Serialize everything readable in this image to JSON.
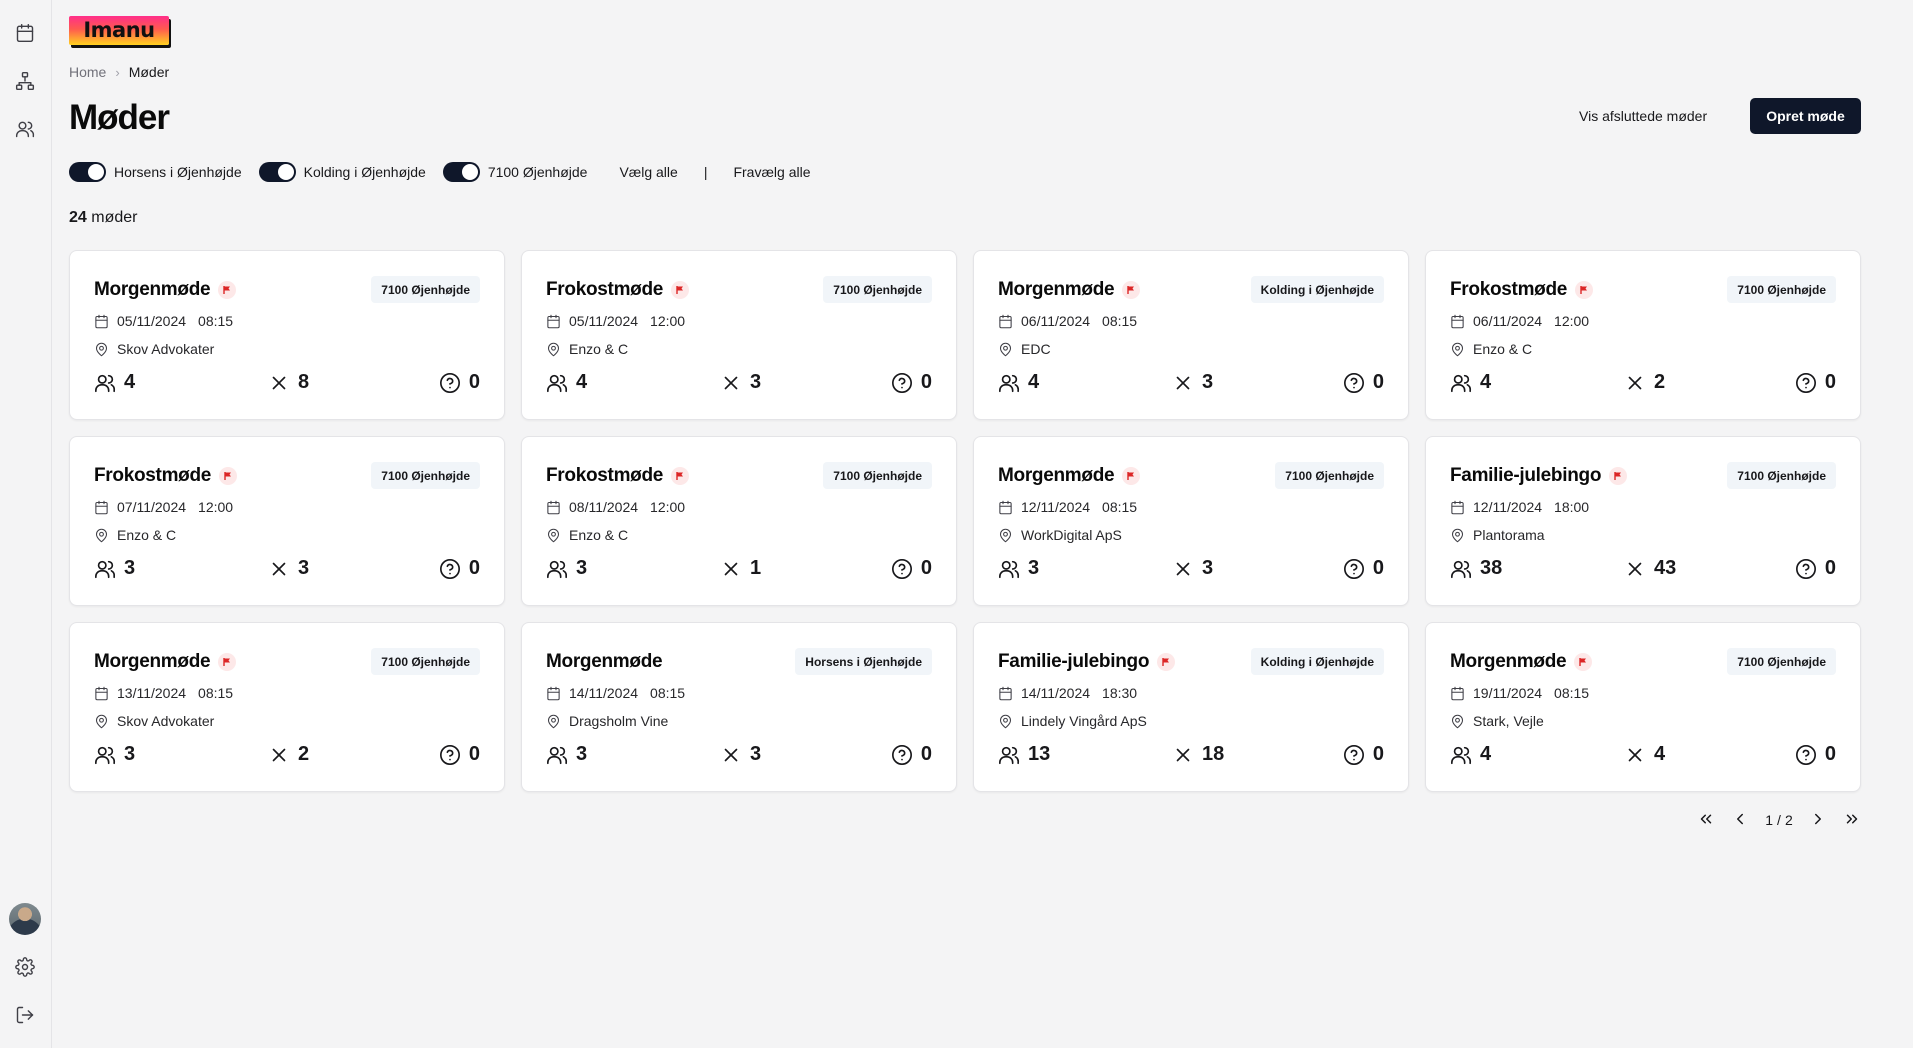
{
  "app": {
    "logo_text": "Imanu"
  },
  "sidebar": {
    "items": [
      {
        "name": "calendar-icon"
      },
      {
        "name": "org-chart-icon"
      },
      {
        "name": "users-icon"
      }
    ],
    "bottom": [
      {
        "name": "avatar"
      },
      {
        "name": "gear-icon"
      },
      {
        "name": "logout-icon"
      }
    ]
  },
  "breadcrumb": {
    "home": "Home",
    "separator": "›",
    "current": "Møder"
  },
  "page": {
    "title": "Møder"
  },
  "actions": {
    "show_finished": "Vis afsluttede møder",
    "create": "Opret møde"
  },
  "filters": {
    "items": [
      {
        "label": "Horsens i Øjenhøjde",
        "on": true
      },
      {
        "label": "Kolding i Øjenhøjde",
        "on": true
      },
      {
        "label": "7100 Øjenhøjde",
        "on": true
      }
    ],
    "select_all": "Vælg alle",
    "divider": "|",
    "deselect_all": "Fravælg alle"
  },
  "summary": {
    "count": "24",
    "unit": "møder"
  },
  "meetings": [
    {
      "title": "Morgenmøde",
      "flagged": true,
      "group": "7100 Øjenhøjde",
      "date": "05/11/2024",
      "time": "08:15",
      "location": "Skov Advokater",
      "attendees": "4",
      "declined": "8",
      "unknown": "0"
    },
    {
      "title": "Frokostmøde",
      "flagged": true,
      "group": "7100 Øjenhøjde",
      "date": "05/11/2024",
      "time": "12:00",
      "location": "Enzo & C",
      "attendees": "4",
      "declined": "3",
      "unknown": "0"
    },
    {
      "title": "Morgenmøde",
      "flagged": true,
      "group": "Kolding i Øjenhøjde",
      "date": "06/11/2024",
      "time": "08:15",
      "location": "EDC",
      "attendees": "4",
      "declined": "3",
      "unknown": "0"
    },
    {
      "title": "Frokostmøde",
      "flagged": true,
      "group": "7100 Øjenhøjde",
      "date": "06/11/2024",
      "time": "12:00",
      "location": "Enzo & C",
      "attendees": "4",
      "declined": "2",
      "unknown": "0"
    },
    {
      "title": "Frokostmøde",
      "flagged": true,
      "group": "7100 Øjenhøjde",
      "date": "07/11/2024",
      "time": "12:00",
      "location": "Enzo & C",
      "attendees": "3",
      "declined": "3",
      "unknown": "0"
    },
    {
      "title": "Frokostmøde",
      "flagged": true,
      "group": "7100 Øjenhøjde",
      "date": "08/11/2024",
      "time": "12:00",
      "location": "Enzo & C",
      "attendees": "3",
      "declined": "1",
      "unknown": "0"
    },
    {
      "title": "Morgenmøde",
      "flagged": true,
      "group": "7100 Øjenhøjde",
      "date": "12/11/2024",
      "time": "08:15",
      "location": "WorkDigital ApS",
      "attendees": "3",
      "declined": "3",
      "unknown": "0"
    },
    {
      "title": "Familie-julebingo",
      "flagged": true,
      "group": "7100 Øjenhøjde",
      "date": "12/11/2024",
      "time": "18:00",
      "location": "Plantorama",
      "attendees": "38",
      "declined": "43",
      "unknown": "0"
    },
    {
      "title": "Morgenmøde",
      "flagged": true,
      "group": "7100 Øjenhøjde",
      "date": "13/11/2024",
      "time": "08:15",
      "location": "Skov Advokater",
      "attendees": "3",
      "declined": "2",
      "unknown": "0"
    },
    {
      "title": "Morgenmøde",
      "flagged": false,
      "group": "Horsens i Øjenhøjde",
      "date": "14/11/2024",
      "time": "08:15",
      "location": "Dragsholm Vine",
      "attendees": "3",
      "declined": "3",
      "unknown": "0"
    },
    {
      "title": "Familie-julebingo",
      "flagged": true,
      "group": "Kolding i Øjenhøjde",
      "date": "14/11/2024",
      "time": "18:30",
      "location": "Lindely Vingård ApS",
      "attendees": "13",
      "declined": "18",
      "unknown": "0"
    },
    {
      "title": "Morgenmøde",
      "flagged": true,
      "group": "7100 Øjenhøjde",
      "date": "19/11/2024",
      "time": "08:15",
      "location": "Stark, Vejle",
      "attendees": "4",
      "declined": "4",
      "unknown": "0"
    }
  ],
  "pagination": {
    "current": "1",
    "separator": "/",
    "total": "2"
  },
  "colors": {
    "primary": "#0f172a",
    "flag": "#dc2626",
    "flag_bg": "#fde8e8",
    "badge_bg": "#f1f5f9",
    "background": "#f4f4f5"
  }
}
